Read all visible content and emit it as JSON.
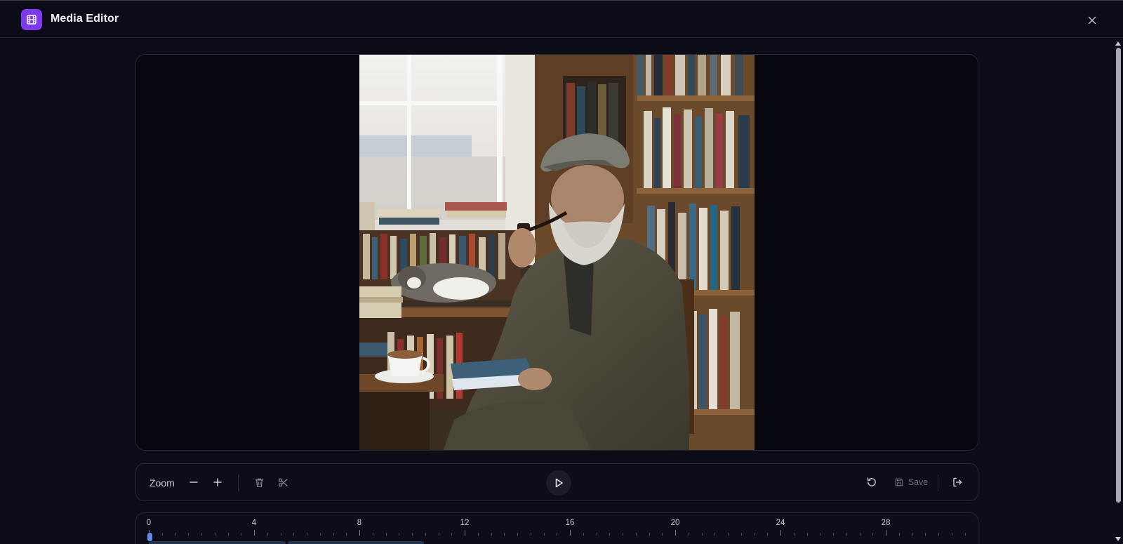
{
  "app": {
    "title": "Media Editor"
  },
  "toolbar": {
    "zoom_label": "Zoom",
    "save_label": "Save"
  },
  "timeline": {
    "ticks": [
      "0",
      "4",
      "8",
      "12",
      "16",
      "20",
      "24",
      "28"
    ]
  },
  "colors": {
    "accent": "#7c3aed",
    "playhead": "#5b8def",
    "background": "#0c0c18",
    "panel": "#0d0d1a"
  },
  "icons": {
    "logo": "film-icon",
    "close": "close-icon",
    "zoom_out": "minus-icon",
    "zoom_in": "plus-icon",
    "delete": "trash-icon",
    "split": "scissors-icon",
    "play": "play-icon",
    "reset": "rotate-ccw-icon",
    "save": "save-icon",
    "exit": "log-out-icon"
  }
}
